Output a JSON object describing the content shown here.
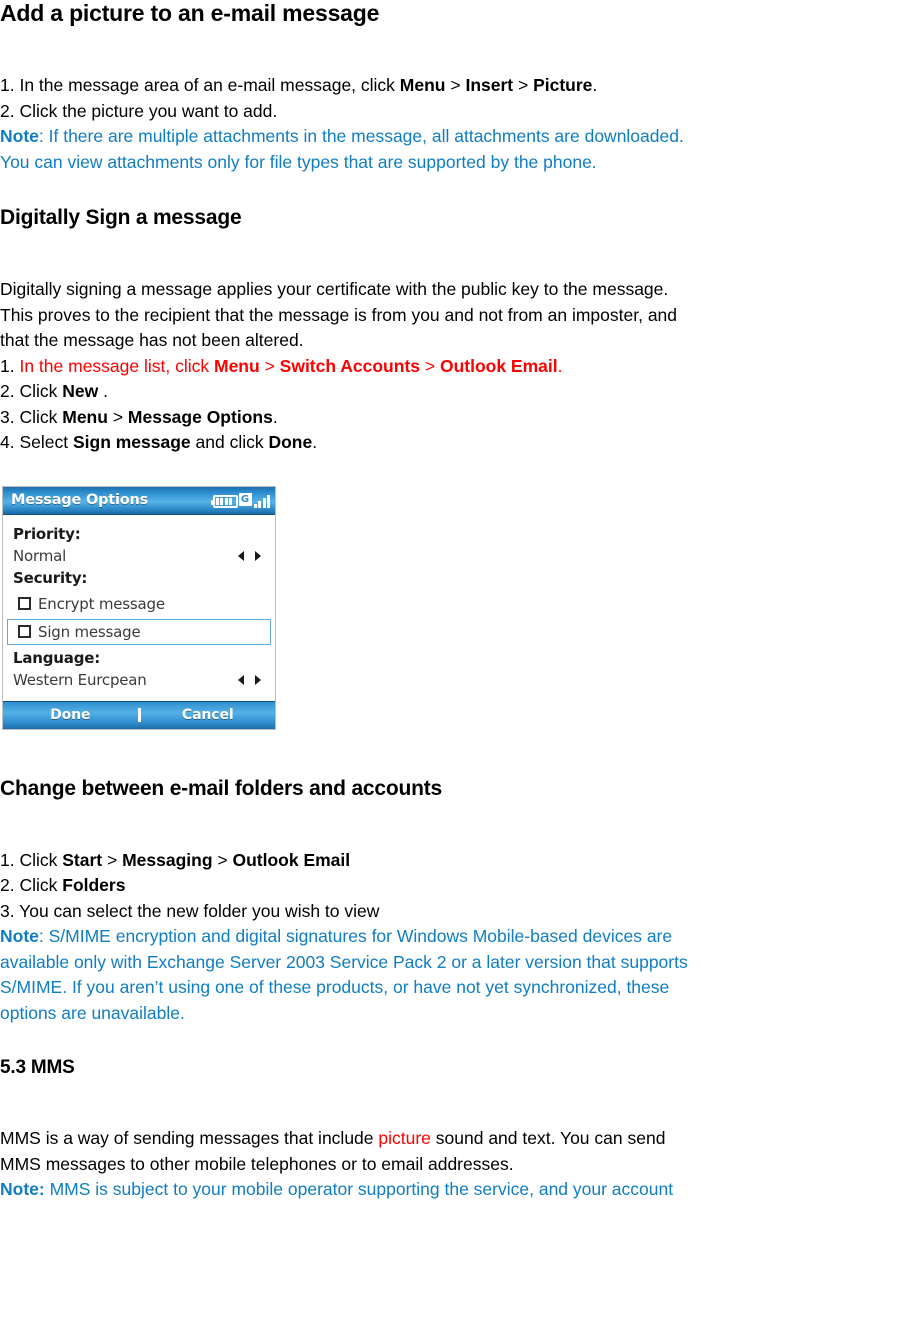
{
  "sections": [
    {
      "heading": "Add a picture to an e-mail message",
      "steps": [
        {
          "num": "1. ",
          "pre": "In the message area of an e-mail message, click ",
          "b1": "Menu",
          "sep1": " > ",
          "b2": "Insert",
          "sep2": " > ",
          "b3": "Picture",
          "post": "."
        },
        {
          "num": "2. ",
          "pre": "Click the picture you want to add.",
          "b1": "",
          "sep1": "",
          "b2": "",
          "sep2": "",
          "b3": "",
          "post": ""
        }
      ],
      "note_label": "Note",
      "note_sep": ": ",
      "note_lines": [
        "If there are multiple attachments in the message, all attachments are downloaded.",
        "You can view attachments only for file types that are supported by the phone."
      ]
    },
    {
      "heading": "Digitally Sign a message",
      "paragraph_lines": [
        "Digitally signing a message applies your certificate with the public key to the message.",
        "This proves to the recipient that the message is from you and not from an imposter, and",
        "that the message has not been altered."
      ],
      "steps_red": {
        "num": "1. ",
        "pre": "In the message list, click ",
        "b1": "Menu",
        "sep1": " > ",
        "b2": "Switch Accounts",
        "sep2": " > ",
        "b3": "Outlook Email",
        "post": "."
      },
      "step2": {
        "num": "2. ",
        "pre": "Click ",
        "b1": "New",
        "post": " ."
      },
      "step3": {
        "num": "3. ",
        "pre": "Click ",
        "b1": "Menu",
        "sep1": " > ",
        "b2": "Message Options",
        "post": "."
      },
      "step4": {
        "num": "4. ",
        "pre": "Select ",
        "b1": "Sign message",
        "mid": " and click ",
        "b2": "Done",
        "post": "."
      }
    },
    {
      "heading": "Change between e-mail folders and accounts",
      "steps": [
        {
          "num": "1. ",
          "pre": "Click ",
          "b1": "Start",
          "sep1": " > ",
          "b2": "Messaging",
          "sep2": " > ",
          "b3": "Outlook Email",
          "post": ""
        },
        {
          "num": "2. ",
          "pre": "Click ",
          "b1": "Folders",
          "post": ""
        },
        {
          "num": "3. ",
          "pre": "You can select the new folder you wish to view",
          "b1": "",
          "post": ""
        }
      ],
      "note_label": "Note",
      "note_sep": ": ",
      "note_lines": [
        "S/MIME encryption and digital signatures for Windows Mobile-based devices are",
        "available only with Exchange Server 2003 Service Pack 2 or a later version that supports",
        "S/MIME. If you aren’t using one of these products, or have not yet synchronized, these",
        "options are unavailable."
      ]
    },
    {
      "heading": "5.3 MMS",
      "body_pre": "MMS is a way of sending messages that include ",
      "body_red": "picture",
      "body_post": " sound and text. You can send",
      "body_line2": "MMS messages to other mobile telephones or to email addresses.",
      "note_label": "Note:",
      "note_sep": " ",
      "note_lines": [
        "MMS is subject to your mobile operator supporting the service, and your account"
      ]
    }
  ],
  "phone_screenshot": {
    "title": "Message Options",
    "status_icons": {
      "battery": "battery-icon",
      "gprs": "G",
      "signal": "signal-bars-icon"
    },
    "priority_label": "Priority:",
    "priority_value": "Normal",
    "security_label": "Security:",
    "encrypt_label": "Encrypt message",
    "sign_label": "Sign message",
    "language_label": "Language:",
    "language_value": "Western Eurcpean",
    "softkey_left": "Done",
    "softkey_right": "Cancel"
  },
  "colors": {
    "note_blue": "#0F7DC2",
    "highlight_red": "#FF0000",
    "titlebar_blue": "#2F8FD0",
    "selection_border": "#5FA9DD"
  }
}
